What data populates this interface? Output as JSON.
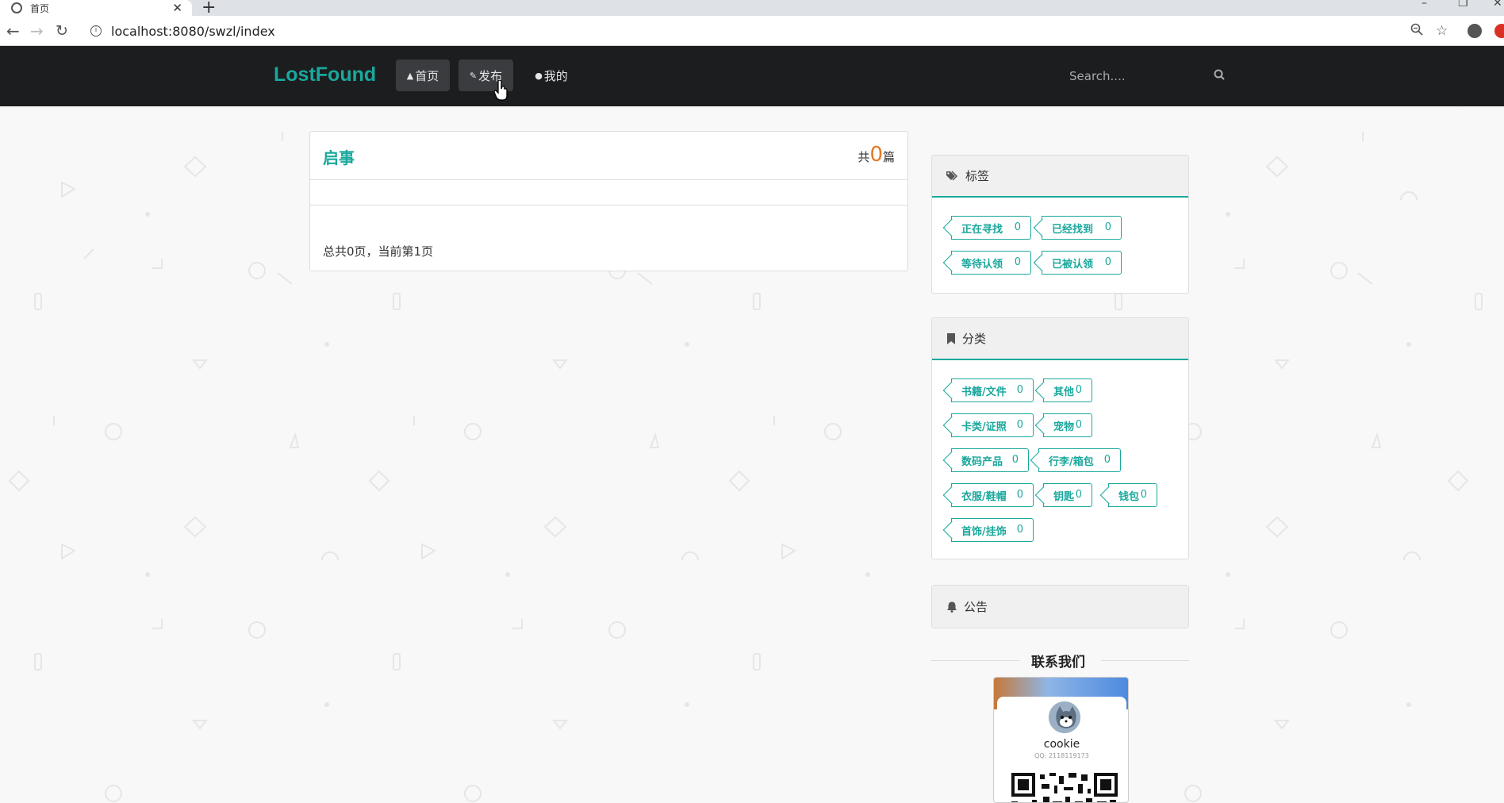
{
  "browser": {
    "tab_title": "首页",
    "url": "localhost:8080/swzl/index"
  },
  "site": {
    "brand": "LostFound",
    "nav": [
      {
        "label": "首页"
      },
      {
        "label": "发布"
      },
      {
        "label": "我的"
      }
    ],
    "search_placeholder": "Search...."
  },
  "main": {
    "title": "启事",
    "count_prefix": "共",
    "count": "0",
    "count_suffix": "篇",
    "pagination": "总共0页，当前第1页"
  },
  "tags_panel": {
    "title": "标签",
    "chips": [
      {
        "label": "正在寻找",
        "count": "0"
      },
      {
        "label": "已经找到",
        "count": "0"
      },
      {
        "label": "等待认领",
        "count": "0"
      },
      {
        "label": "已被认领",
        "count": "0"
      }
    ]
  },
  "category_panel": {
    "title": "分类",
    "chips": [
      {
        "label": "书籍/文件",
        "count": "0"
      },
      {
        "label": "其他",
        "count": "0"
      },
      {
        "label": "卡类/证照",
        "count": "0"
      },
      {
        "label": "宠物",
        "count": "0"
      },
      {
        "label": "数码产品",
        "count": "0"
      },
      {
        "label": "行李/箱包",
        "count": "0"
      },
      {
        "label": "衣服/鞋帽",
        "count": "0"
      },
      {
        "label": "钥匙",
        "count": "0"
      },
      {
        "label": "钱包",
        "count": "0"
      },
      {
        "label": "首饰/挂饰",
        "count": "0"
      }
    ]
  },
  "notice_panel": {
    "title": "公告"
  },
  "contact": {
    "title": "联系我们",
    "name": "cookie",
    "qq": "QQ: 2118119173"
  },
  "colors": {
    "accent": "#1aa89c",
    "navbar": "#1c1d1f",
    "count_highlight": "#e07a25"
  }
}
